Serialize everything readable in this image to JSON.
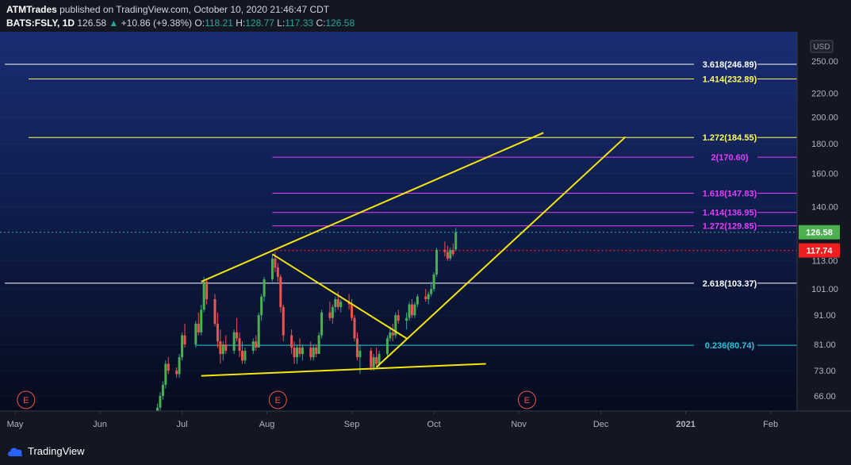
{
  "header": {
    "author": "ATMTrades",
    "published_text": " published on TradingView.com, October 10, 2020 21:46:47 CDT",
    "symbol": "BATS:FSLY, 1D",
    "last": "126.58",
    "change_arrow": "▲",
    "change": "+10.86 (+9.38%)",
    "o_label": "O:",
    "o_value": "118.21",
    "h_label": "H:",
    "h_value": "128.77",
    "l_label": "L:",
    "l_value": "117.33",
    "c_label": "C:",
    "c_value": "126.58"
  },
  "footer": {
    "brand": "TradingView"
  },
  "chart_data": {
    "type": "candlestick",
    "currency": "USD",
    "y_scale": "log",
    "ylim": [
      62,
      275
    ],
    "y_ticks": [
      "66.00",
      "73.00",
      "81.00",
      "91.00",
      "101.00",
      "113.00",
      "140.00",
      "160.00",
      "180.00",
      "200.00",
      "220.00",
      "250.00"
    ],
    "x_ticks": [
      "May",
      "Jun",
      "Jul",
      "Aug",
      "Sep",
      "Oct",
      "Nov",
      "Dec",
      "2021",
      "Feb"
    ],
    "bold_x_ticks": [
      "2021"
    ],
    "price_labels": [
      {
        "text": "126.58",
        "color": "#4caf50",
        "value": 126.58
      },
      {
        "text": "117.74",
        "color": "#f01f1f",
        "value": 117.74
      }
    ],
    "levels": [
      {
        "text": "3.618(246.89)",
        "value": 246.89,
        "color": "#ffffff",
        "from": "May 1"
      },
      {
        "text": "1.414(232.89)",
        "value": 232.89,
        "color": "#ffff5a",
        "from": "May 8"
      },
      {
        "text": "1.272(184.55)",
        "value": 184.55,
        "color": "#ffff5a",
        "from": "May 8"
      },
      {
        "text": "2(170.60)",
        "value": 170.6,
        "color": "#e040fb",
        "from": "Aug 3"
      },
      {
        "text": "1.618(147.83)",
        "value": 147.83,
        "color": "#e040fb",
        "from": "Aug 3"
      },
      {
        "text": "1.414(136.95)",
        "value": 136.95,
        "color": "#e040fb",
        "from": "Aug 3"
      },
      {
        "text": "1.272(129.85)",
        "value": 129.85,
        "color": "#e040fb",
        "from": "Aug 3"
      },
      {
        "text": "2.618(103.37)",
        "value": 103.37,
        "color": "#ffffff",
        "from": "May 1"
      },
      {
        "text": "0.236(80.74)",
        "value": 80.74,
        "color": "#26c6da",
        "from": "Jul 6"
      }
    ],
    "earnings_markers": [
      {
        "text": "E",
        "date": "May 5"
      },
      {
        "text": "E",
        "date": "Aug 5"
      },
      {
        "text": "E",
        "date": "Nov 4"
      }
    ],
    "trendlines": [
      {
        "from": [
          "Jul 8",
          104
        ],
        "to": [
          "Nov 10",
          188
        ]
      },
      {
        "from": [
          "Jul 8",
          71.5
        ],
        "to": [
          "Oct 20",
          75
        ]
      },
      {
        "from": [
          "Aug 3",
          116
        ],
        "to": [
          "Sep 21",
          83
        ]
      },
      {
        "from": [
          "Sep 10",
          74
        ],
        "to": [
          "Dec 10",
          185
        ]
      }
    ],
    "dotted_lines": [
      {
        "value": 126.58,
        "color": "#26a69a"
      },
      {
        "value": 117.74,
        "color": "#f01f1f"
      }
    ],
    "candles": [
      [
        "Jun 22",
        62,
        64,
        61,
        63
      ],
      [
        "Jun 23",
        63,
        67,
        62,
        66
      ],
      [
        "Jun 24",
        66,
        70,
        65,
        69
      ],
      [
        "Jun 25",
        69,
        76,
        68,
        75
      ],
      [
        "Jun 26",
        75,
        77,
        72,
        73
      ],
      [
        "Jun 29",
        73,
        74,
        71,
        72
      ],
      [
        "Jun 30",
        72,
        78,
        71,
        77
      ],
      [
        "Jul 1",
        77,
        85,
        76,
        84
      ],
      [
        "Jul 2",
        84,
        88,
        80,
        81
      ],
      [
        "Jul 6",
        81,
        89,
        80,
        88
      ],
      [
        "Jul 7",
        88,
        92,
        84,
        85
      ],
      [
        "Jul 8",
        85,
        95,
        84,
        93
      ],
      [
        "Jul 9",
        93,
        106,
        92,
        104
      ],
      [
        "Jul 10",
        104,
        105,
        95,
        97
      ],
      [
        "Jul 13",
        97,
        99,
        87,
        88
      ],
      [
        "Jul 14",
        88,
        92,
        80,
        82
      ],
      [
        "Jul 15",
        82,
        86,
        75,
        78
      ],
      [
        "Jul 16",
        78,
        82,
        76,
        81
      ],
      [
        "Jul 17",
        81,
        84,
        78,
        79
      ],
      [
        "Jul 20",
        79,
        86,
        78,
        85
      ],
      [
        "Jul 21",
        85,
        90,
        82,
        83
      ],
      [
        "Jul 22",
        83,
        85,
        77,
        79
      ],
      [
        "Jul 23",
        79,
        82,
        75,
        76
      ],
      [
        "Jul 24",
        76,
        80,
        75,
        79
      ],
      [
        "Jul 27",
        79,
        83,
        78,
        82
      ],
      [
        "Jul 28",
        82,
        84,
        79,
        80
      ],
      [
        "Jul 29",
        80,
        92,
        80,
        91
      ],
      [
        "Jul 30",
        91,
        99,
        89,
        98
      ],
      [
        "Jul 31",
        98,
        106,
        96,
        105
      ],
      [
        "Aug 3",
        105,
        116,
        104,
        114
      ],
      [
        "Aug 4",
        114,
        117,
        108,
        110
      ],
      [
        "Aug 5",
        110,
        112,
        104,
        106
      ],
      [
        "Aug 6",
        106,
        107,
        92,
        94
      ],
      [
        "Aug 7",
        94,
        95,
        82,
        84
      ],
      [
        "Aug 10",
        84,
        86,
        78,
        80
      ],
      [
        "Aug 11",
        80,
        82,
        75,
        77
      ],
      [
        "Aug 12",
        77,
        81,
        75,
        80
      ],
      [
        "Aug 13",
        80,
        83,
        77,
        78
      ],
      [
        "Aug 14",
        78,
        81,
        76,
        80
      ],
      [
        "Aug 17",
        80,
        82,
        76,
        77
      ],
      [
        "Aug 18",
        77,
        81,
        76,
        80
      ],
      [
        "Aug 19",
        80,
        81,
        77,
        78
      ],
      [
        "Aug 20",
        78,
        85,
        78,
        84
      ],
      [
        "Aug 21",
        84,
        93,
        83,
        92
      ],
      [
        "Aug 24",
        92,
        96,
        89,
        90
      ],
      [
        "Aug 25",
        90,
        95,
        88,
        94
      ],
      [
        "Aug 26",
        94,
        98,
        92,
        97
      ],
      [
        "Aug 27",
        97,
        100,
        93,
        94
      ],
      [
        "Aug 28",
        94,
        97,
        92,
        96
      ],
      [
        "Aug 31",
        96,
        99,
        93,
        95
      ],
      [
        "Sep 1",
        95,
        97,
        89,
        90
      ],
      [
        "Sep 2",
        90,
        91,
        82,
        83
      ],
      [
        "Sep 3",
        83,
        85,
        76,
        77
      ],
      [
        "Sep 4",
        77,
        81,
        72,
        79
      ],
      [
        "Sep 8",
        79,
        80,
        73,
        74
      ],
      [
        "Sep 9",
        74,
        78,
        73,
        77
      ],
      [
        "Sep 10",
        77,
        80,
        74,
        75
      ],
      [
        "Sep 11",
        75,
        79,
        74,
        78
      ],
      [
        "Sep 14",
        78,
        84,
        77,
        83
      ],
      [
        "Sep 15",
        83,
        87,
        82,
        85
      ],
      [
        "Sep 16",
        85,
        88,
        82,
        84
      ],
      [
        "Sep 17",
        84,
        92,
        83,
        91
      ],
      [
        "Sep 18",
        91,
        93,
        88,
        89
      ],
      [
        "Sep 21",
        89,
        92,
        86,
        90
      ],
      [
        "Sep 22",
        90,
        96,
        89,
        95
      ],
      [
        "Sep 23",
        95,
        97,
        90,
        91
      ],
      [
        "Sep 24",
        91,
        96,
        90,
        95
      ],
      [
        "Sep 25",
        95,
        99,
        94,
        98
      ],
      [
        "Sep 28",
        98,
        101,
        96,
        97
      ],
      [
        "Sep 29",
        97,
        100,
        95,
        99
      ],
      [
        "Sep 30",
        99,
        104,
        98,
        101
      ],
      [
        "Oct 1",
        101,
        108,
        100,
        107
      ],
      [
        "Oct 2",
        107,
        119,
        106,
        118
      ],
      [
        "Oct 5",
        118,
        122,
        115,
        117
      ],
      [
        "Oct 6",
        117,
        120,
        113,
        114
      ],
      [
        "Oct 7",
        114,
        119,
        113,
        118
      ],
      [
        "Oct 8",
        118,
        121,
        115,
        116
      ],
      [
        "Oct 9",
        118.21,
        128.77,
        117.33,
        126.58
      ]
    ]
  }
}
